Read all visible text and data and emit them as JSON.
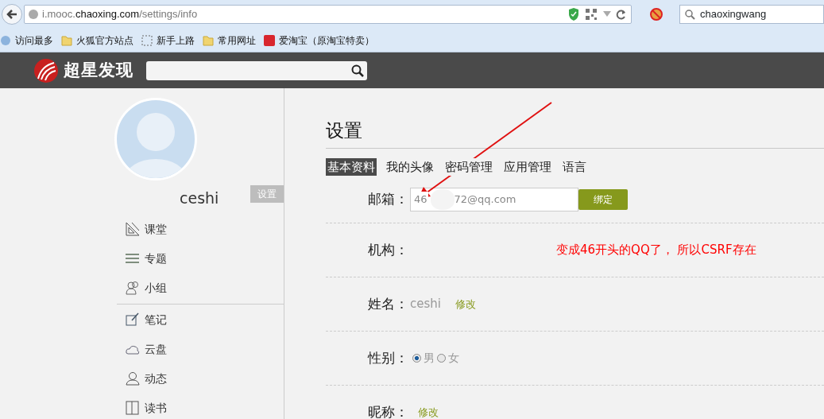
{
  "browser": {
    "url_host_prefix": "i.mooc.",
    "url_host": "chaoxing.com",
    "url_path": "/settings/info",
    "search_value": "chaoxingwang"
  },
  "bookmarks": [
    {
      "label": "访问最多",
      "kind": "smart"
    },
    {
      "label": "火狐官方站点",
      "kind": "folder"
    },
    {
      "label": "新手上路",
      "kind": "dashed"
    },
    {
      "label": "常用网址",
      "kind": "folder"
    },
    {
      "label": "爱淘宝（原淘宝特卖）",
      "kind": "taobao"
    }
  ],
  "site": {
    "logo_text": "超星发现"
  },
  "profile": {
    "name": "ceshi",
    "settings_button": "设置"
  },
  "sidebar": {
    "groups": [
      {
        "items": [
          {
            "label": "课堂",
            "kind": "triangle"
          },
          {
            "label": "专题",
            "kind": "lines"
          },
          {
            "label": "小组",
            "kind": "group"
          }
        ]
      },
      {
        "items": [
          {
            "label": "笔记",
            "kind": "note"
          },
          {
            "label": "云盘",
            "kind": "cloud"
          },
          {
            "label": "动态",
            "kind": "person"
          },
          {
            "label": "读书",
            "kind": "book"
          }
        ]
      }
    ]
  },
  "settings": {
    "title": "设置",
    "tabs": [
      {
        "label": "基本资料",
        "selected": true
      },
      {
        "label": "我的头像",
        "selected": false
      },
      {
        "label": "密码管理",
        "selected": false
      },
      {
        "label": "应用管理",
        "selected": false
      },
      {
        "label": "语言",
        "selected": false
      }
    ],
    "rows": [
      {
        "kind": "email",
        "label": "邮箱：",
        "value_start": "46",
        "value_end": "72@qq.com",
        "redacted": true,
        "button": "绑定"
      },
      {
        "kind": "text",
        "label": "机构："
      },
      {
        "kind": "editable",
        "label": "姓名：",
        "value": "ceshi",
        "link": "修改"
      },
      {
        "kind": "radio",
        "label": "性别：",
        "options": [
          {
            "label": "男",
            "selected": true
          },
          {
            "label": "女",
            "selected": false
          }
        ]
      },
      {
        "kind": "editable",
        "label": "昵称：",
        "link": "修改"
      }
    ]
  },
  "annotation": {
    "text": "变成46开头的QQ了， 所以CSRF存在"
  }
}
